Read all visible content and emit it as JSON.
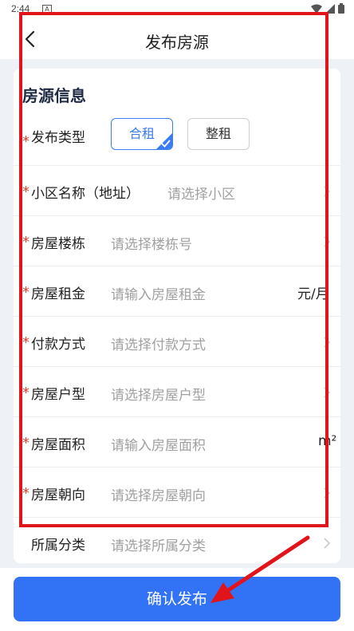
{
  "status": {
    "time": "2:44",
    "notif": "A"
  },
  "header": {
    "title": "发布房源"
  },
  "section": {
    "title": "房源信息"
  },
  "required_mark": "*",
  "type_row": {
    "label": "发布类型",
    "options": [
      "合租",
      "整租"
    ],
    "selected": "合租"
  },
  "fields": [
    {
      "label": "小区名称（地址）",
      "placeholder": "请选择小区",
      "required": true
    },
    {
      "label": "房屋楼栋",
      "placeholder": "请选择楼栋号",
      "required": true
    },
    {
      "label": "房屋租金",
      "placeholder": "请输入房屋租金",
      "unit": "元/月",
      "required": true
    },
    {
      "label": "付款方式",
      "placeholder": "请选择付款方式",
      "required": true
    },
    {
      "label": "房屋户型",
      "placeholder": "请选择房屋户型",
      "required": true
    },
    {
      "label": "房屋面积",
      "placeholder": "请输入房屋面积",
      "unit": "m²",
      "required": true
    },
    {
      "label": "房屋朝向",
      "placeholder": "请选择房屋朝向",
      "required": true
    },
    {
      "label": "所属分类",
      "placeholder": "请选择所属分类",
      "required": false
    }
  ],
  "footer": {
    "confirm_label": "确认发布"
  },
  "colors": {
    "accent": "#3273f6",
    "required": "#e3402f",
    "highlight": "#e0141a"
  },
  "icons": [
    "back-arrow-icon",
    "chevron-right-icon",
    "check-icon",
    "wifi-icon",
    "signal-icon",
    "battery-icon"
  ]
}
